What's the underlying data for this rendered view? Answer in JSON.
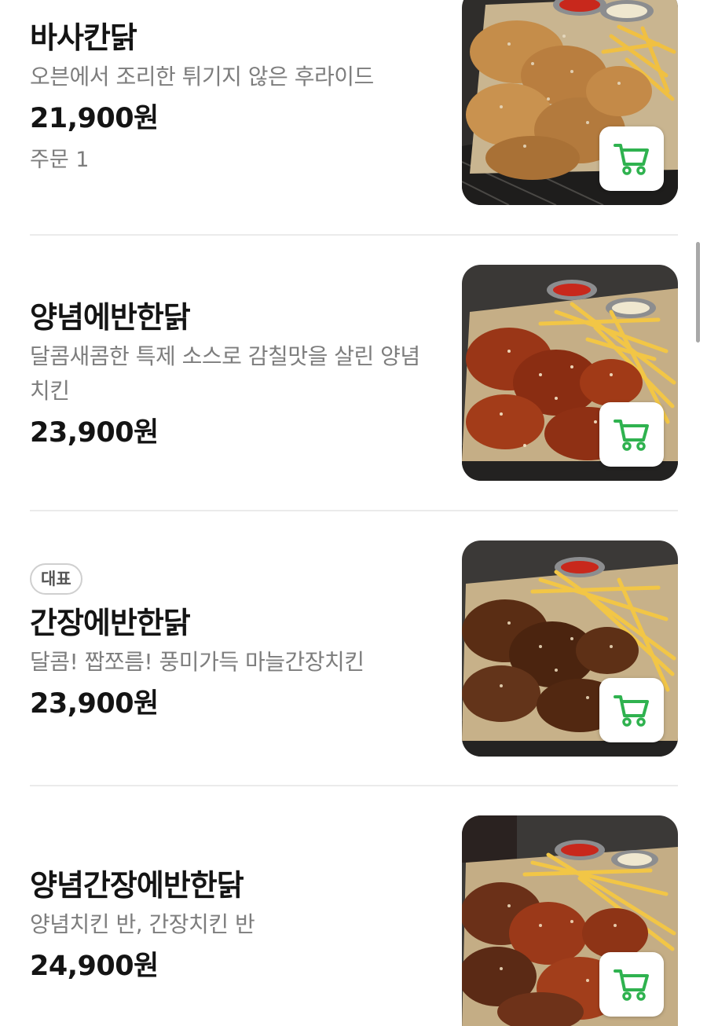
{
  "menu": {
    "items": [
      {
        "name": "바사칸닭",
        "description": "오븐에서 조리한 튀기지 않은 후라이드",
        "price": "21,900원",
        "orders": "주문 1"
      },
      {
        "name": "양념에반한닭",
        "description": "달콤새콤한 특제 소스로 감칠맛을 살린 양념치킨",
        "price": "23,900원"
      },
      {
        "badge": "대표",
        "name": "간장에반한닭",
        "description": "달콤! 짭쪼름! 풍미가득 마늘간장치킨",
        "price": "23,900원"
      },
      {
        "name": "양념간장에반한닭",
        "description": "양념치킨 반, 간장치킨 반",
        "price": "24,900원"
      }
    ]
  },
  "icons": {
    "cart": "shopping-cart-icon"
  },
  "colors": {
    "cart_accent": "#2fb24f",
    "name_text": "#141414",
    "secondary_text": "#7d7d7d",
    "divider": "#ebebeb"
  }
}
